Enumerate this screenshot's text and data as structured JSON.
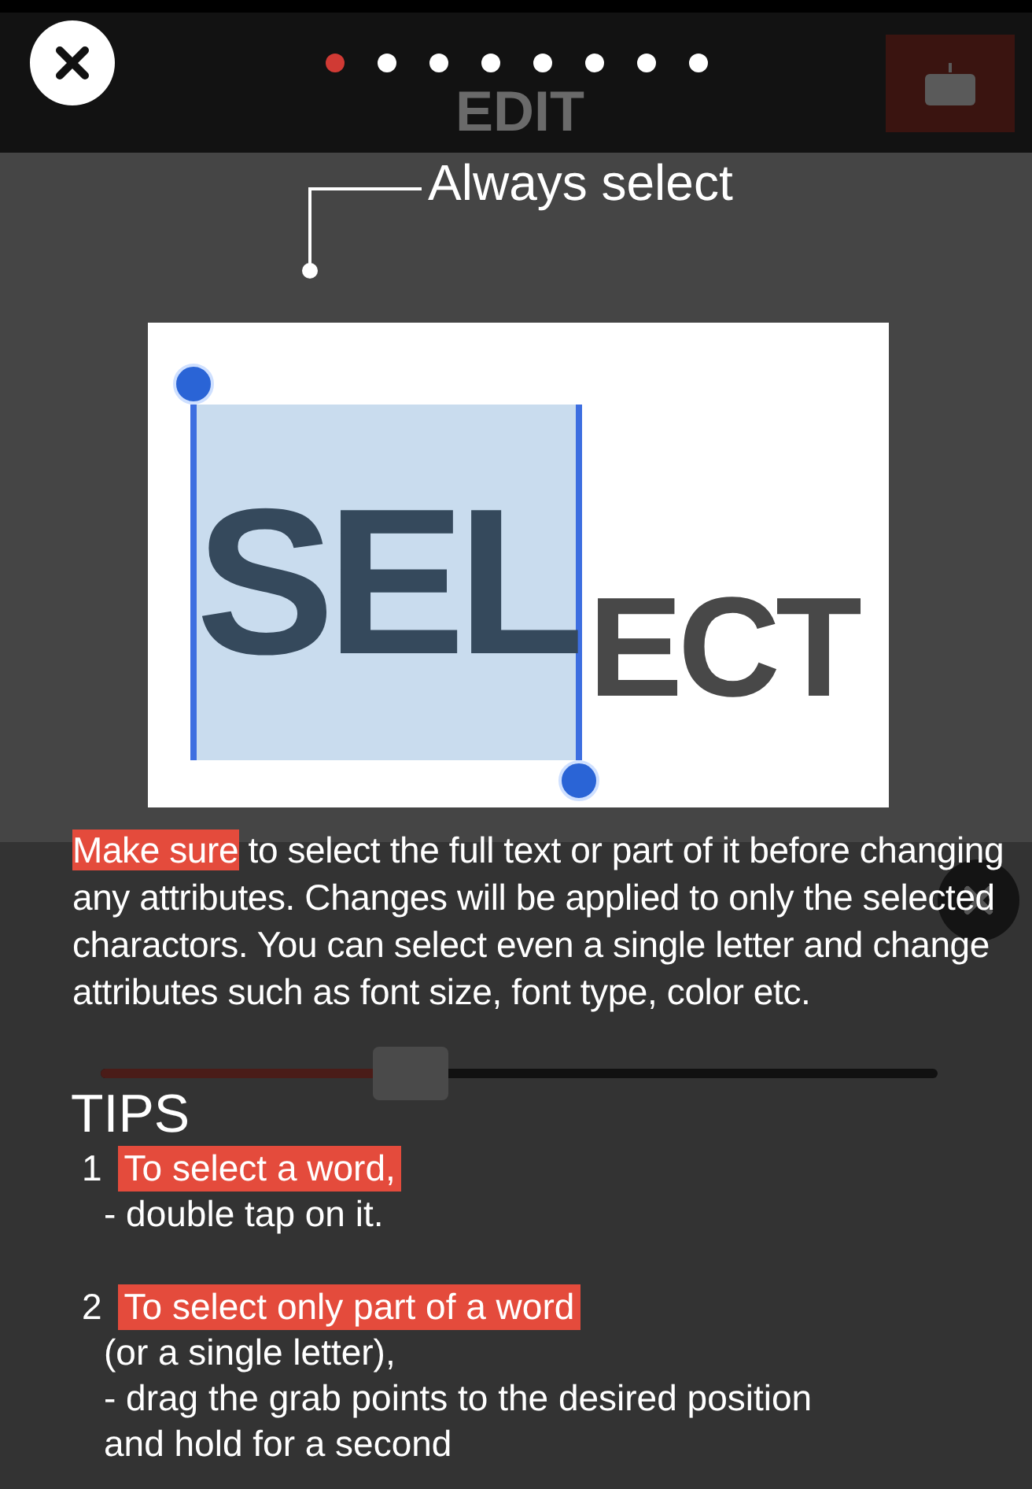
{
  "app": {
    "title": "EDIT",
    "slider": {
      "level": 0.37
    }
  },
  "pager": {
    "dots": [
      {
        "selected": true
      },
      {
        "selected": false
      },
      {
        "selected": false
      },
      {
        "selected": false
      },
      {
        "selected": false
      },
      {
        "selected": false
      },
      {
        "selected": false
      },
      {
        "selected": false
      }
    ]
  },
  "callout": {
    "label": "Always select"
  },
  "example": {
    "selected_part": "SEL",
    "rest": "ECT"
  },
  "intro": {
    "highlight": "Make sure",
    "text": " to select the full text or part of it before changing any attributes. Changes will be applied to only the selected charactors. You can select even a single letter and change attributes such as font size, font type, color etc."
  },
  "tips": {
    "title": "TIPS",
    "items": [
      {
        "number": "1",
        "highlight": "To select a word,",
        "lines": [
          "- double tap on it."
        ]
      },
      {
        "number": "2",
        "highlight": "To select only part of a word",
        "lines": [
          "(or a single letter),",
          "-  drag the grab points to the desired position",
          "and hold for a second"
        ]
      }
    ]
  }
}
